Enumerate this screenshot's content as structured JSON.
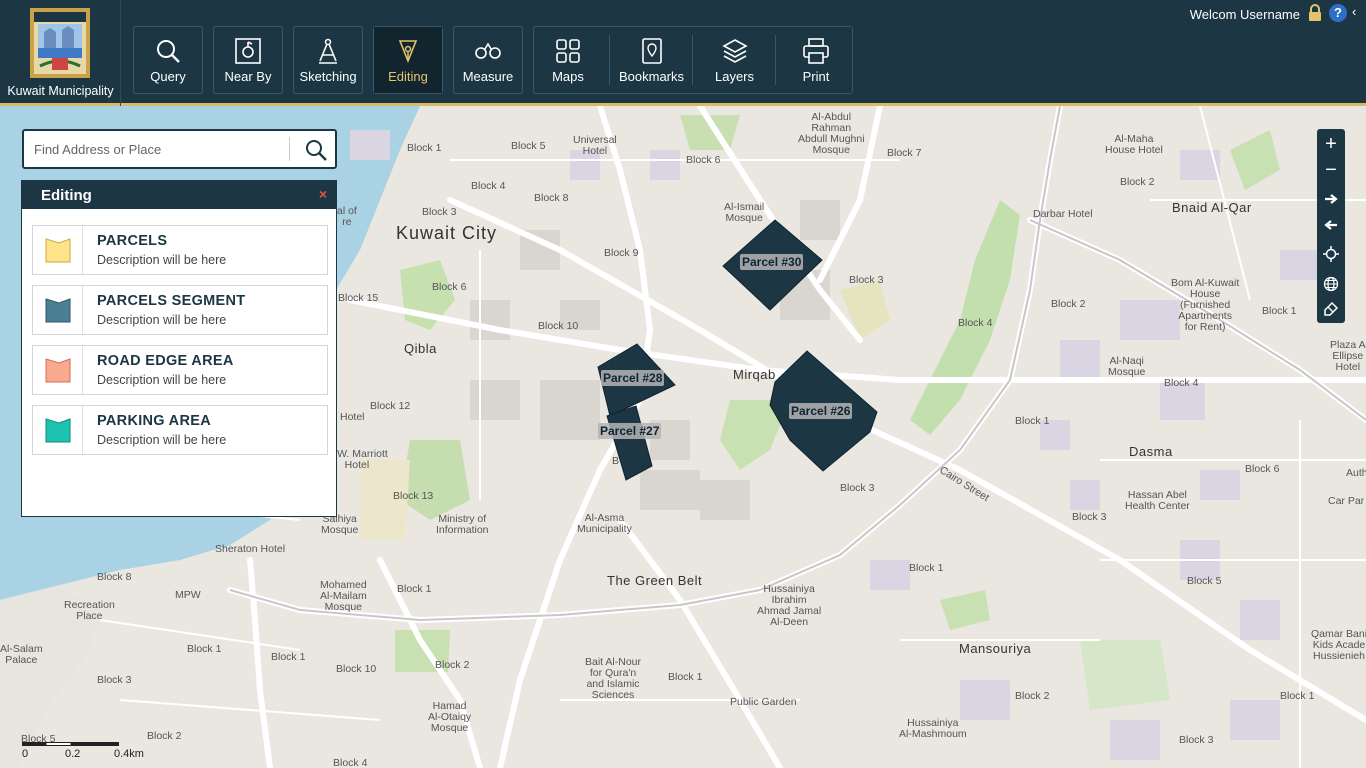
{
  "brand": {
    "name": "Kuwait Municipality"
  },
  "toolbar": {
    "query": "Query",
    "nearby": "Near By",
    "sketching": "Sketching",
    "editing": "Editing",
    "measure": "Measure",
    "maps": "Maps",
    "bookmarks": "Bookmarks",
    "layers": "Layers",
    "print": "Print",
    "active": "editing"
  },
  "user": {
    "welcome": "Welcom Username"
  },
  "search": {
    "placeholder": "Find Address or Place"
  },
  "panel": {
    "title": "Editing",
    "close": "×",
    "items": [
      {
        "name": "PARCELS",
        "desc": "Description will be here",
        "color": "#fde38a",
        "border": "#cfa93b"
      },
      {
        "name": "PARCELS SEGMENT",
        "desc": "Description will be here",
        "color": "#4b7f95",
        "border": "#2f5566"
      },
      {
        "name": "ROAD EDGE AREA",
        "desc": "Description will be here",
        "color": "#f8a990",
        "border": "#d36d52"
      },
      {
        "name": "PARKING AREA",
        "desc": "Description will be here",
        "color": "#1ec2b0",
        "border": "#138a7d"
      }
    ]
  },
  "map": {
    "parcels": [
      "Parcel #30",
      "Parcel #28",
      "Parcel #27",
      "Parcel #26"
    ],
    "labels": {
      "kuwait_city": "Kuwait City",
      "qibla": "Qibla",
      "mirqab": "Mirqab",
      "dasma": "Dasma",
      "green_belt": "The Green Belt",
      "mansouriya": "Mansouriya",
      "bnaid_al_qar": "Bnaid Al-Qar",
      "cairo_street": "Cairo Street",
      "universal_hotel": "Universal\nHotel",
      "al_rahman": "Al-Abdul\nRahman\nAbdull Mughni\nMosque",
      "al_ismail": "Al-Ismail\nMosque",
      "al_maha": "Al-Maha\nHouse Hotel",
      "darbar": "Darbar Hotel",
      "bom_al_kuwait": "Bom Al-Kuwait\nHouse\n(Furnished\nApartments\nfor Rent)",
      "al_naqi": "Al-Naqi\nMosque",
      "hassan_abel": "Hassan Abel\nHealth Center",
      "sheraton": "Sheraton Hotel",
      "marriott": "J. W. Marriott\nHotel",
      "salhiya": "Salhiya\nMosque",
      "ministry": "Ministry of\nInformation",
      "al_asma": "Al-Asma\nMunicipality",
      "mohamed": "Mohamed\nAl-Mailam\nMosque",
      "mpw": "MPW",
      "recreation": "Recreation\nPlace",
      "al_salam": "Al-Salam\nPalace",
      "hussainiya": "Hussainiya\nIbrahim\nAhmad Jamal\nAl-Deen",
      "bait_al_nour": "Bait Al-Nour\nfor Qura'n\nand Islamic\nSciences",
      "public_garden": "Public Garden",
      "hamad": "Hamad\nAl-Otaiqy\nMosque",
      "hussainiya2": "Hussainiya\nAl-Mashmoum",
      "qamar_bani": "Qamar Bani\nKids Acade\nHussienieh",
      "plaza": "Plaza A\nEllipse\nHotel",
      "hotel_left": "Hotel",
      "tem": "al of\nre",
      "b1a": "Block 1",
      "b5": "Block 5",
      "b6a": "Block 6",
      "b7": "Block 7",
      "b4a": "Block 4",
      "b8": "Block 8",
      "b3a": "Block 3",
      "b9": "Block 9",
      "b6b": "Block 6",
      "b15": "Block 15",
      "b10": "Block 10",
      "b12": "Block 12",
      "b13": "Block 13",
      "b3b": "Block 3",
      "b3c": "Block 3",
      "b4b": "Block 4",
      "b2a": "Block 2",
      "b1b": "Block 1",
      "b4c": "Block 4",
      "b1c": "Block 1",
      "b6c": "Block 6",
      "b3d": "Block 3",
      "b5b": "Block 5",
      "b1d": "Block 1",
      "b8b": "Block 8",
      "b1e": "Block 1",
      "b1f": "Block 1",
      "b10b": "Block 10",
      "b2b": "Block 2",
      "b1g": "Block 1",
      "b3e": "Block 3",
      "b2c": "Block 2",
      "b1h": "Block 1",
      "b2d": "Block 2",
      "b3f": "Block 3",
      "b1i": "Block 1",
      "b5c": "Block 5",
      "b4d": "Block 4",
      "b2top": "Block 2",
      "bB": "B",
      "b2e": "Block 2",
      "auth": "Auth",
      "carpar": "Car Par"
    }
  },
  "scale": {
    "t0": "0",
    "t1": "0.2",
    "t2": "0.4km",
    "unit": "km"
  }
}
